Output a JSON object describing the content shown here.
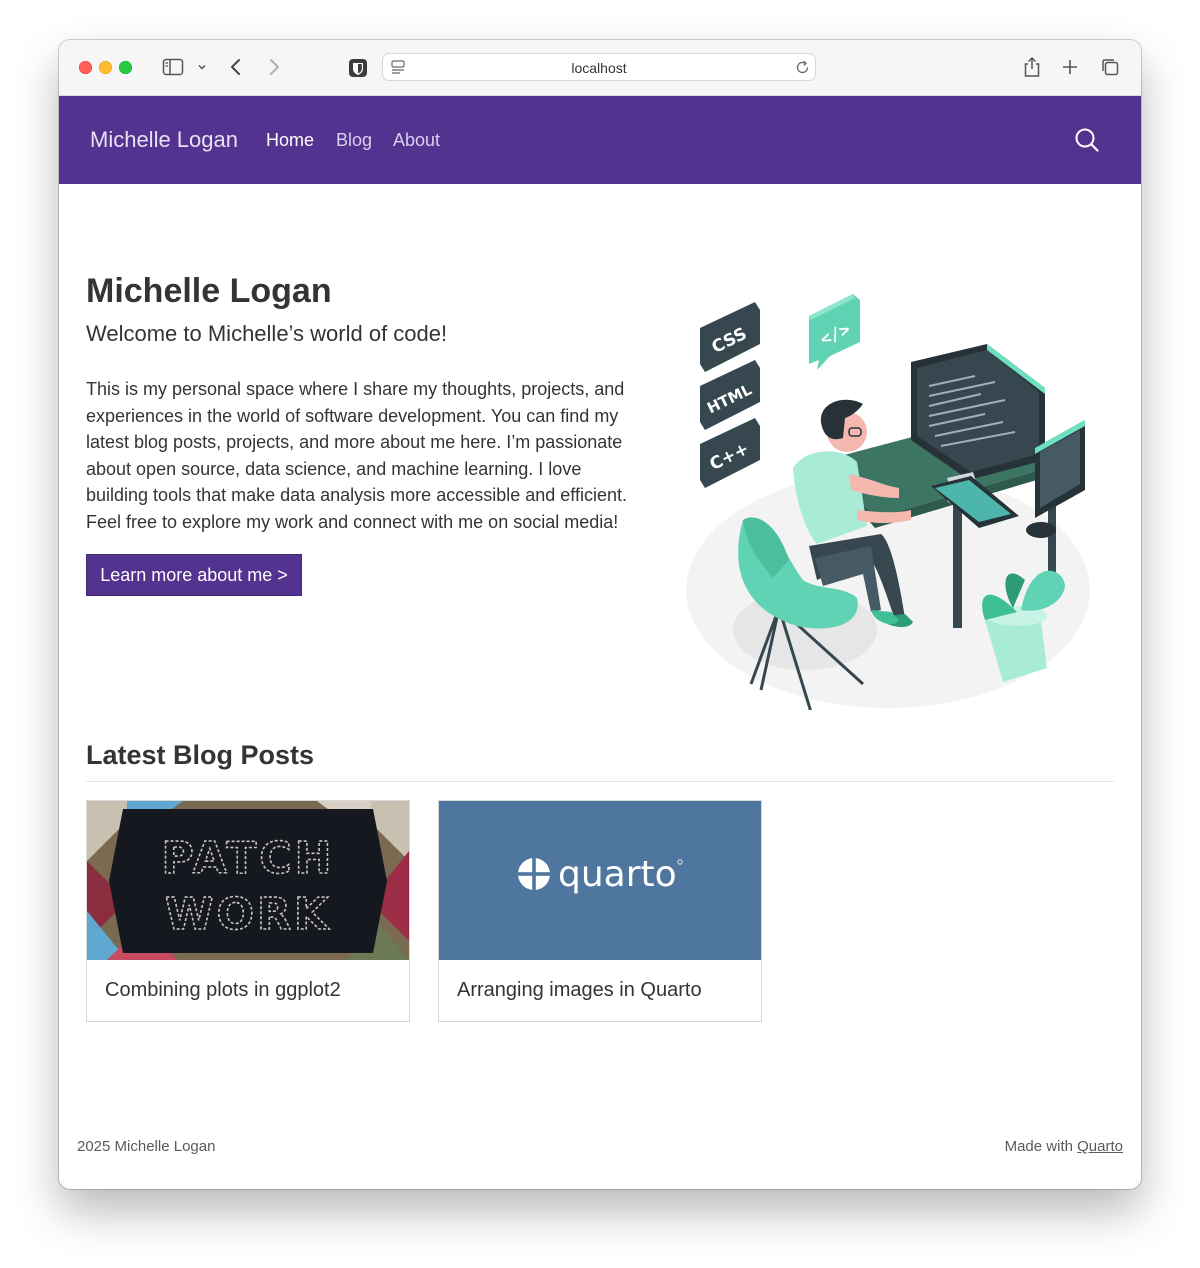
{
  "browser": {
    "url": "localhost",
    "icons": [
      "sidebar-icon",
      "chevron-down-icon",
      "back-icon",
      "forward-icon",
      "password-manager-icon",
      "page-settings-icon",
      "reload-icon",
      "share-icon",
      "new-tab-icon",
      "tab-overview-icon"
    ]
  },
  "site": {
    "brand": "Michelle Logan",
    "nav": {
      "home": "Home",
      "blog": "Blog",
      "about": "About"
    },
    "accent_color": "#543390"
  },
  "hero": {
    "title": "Michelle Logan",
    "subtitle": "Welcome to Michelle’s world of code!",
    "body_lines": [
      "This is my personal space where I share my thoughts, projects, and",
      "experiences in the world of software development. You can find my",
      "latest blog posts, projects, and more about me here. I’m passionate",
      "about open source, data science, and machine learning. I love",
      "building tools that make data analysis more accessible and efficient.",
      "Feel free to explore my work and connect with me on social media!"
    ],
    "cta_label": "Learn more about me >",
    "illustration_labels": {
      "css": "CSS",
      "html": "HTML",
      "cpp": "C++",
      "code": "</>"
    }
  },
  "blog": {
    "section_title": "Latest Blog Posts",
    "posts": [
      {
        "title": "Combining plots in ggplot2",
        "thumb_text": [
          "PATCH",
          "WORK"
        ]
      },
      {
        "title": "Arranging images in Quarto",
        "thumb_text": [
          "quarto"
        ]
      }
    ]
  },
  "footer": {
    "left": "2025 Michelle Logan",
    "right_prefix": "Made with",
    "right_link": "Quarto"
  }
}
